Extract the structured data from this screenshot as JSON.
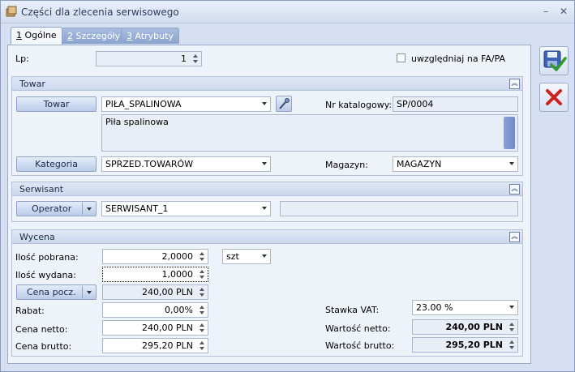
{
  "window": {
    "title": "Części dla zlecenia serwisowego",
    "minimize": "–",
    "close": "✕"
  },
  "tabs": [
    {
      "num": "1",
      "label": "Ogólne"
    },
    {
      "num": "2",
      "label": "Szczegóły"
    },
    {
      "num": "3",
      "label": "Atrybuty"
    }
  ],
  "top": {
    "lp_label": "Lp:",
    "lp_value": "1",
    "checkbox_label": "uwzględniaj na FA/PA"
  },
  "towar": {
    "title": "Towar",
    "button": "Towar",
    "value": "PIŁA_SPALINOWA",
    "catalog_label": "Nr katalogowy:",
    "catalog_value": "SP/0004",
    "description": "Piła spalinowa",
    "category_button": "Kategoria",
    "category_value": "SPRZED.TOWARÓW",
    "warehouse_label": "Magazyn:",
    "warehouse_value": "MAGAZYN"
  },
  "serwisant": {
    "title": "Serwisant",
    "button": "Operator",
    "value": "SERWISANT_1",
    "extra": ""
  },
  "wycena": {
    "title": "Wycena",
    "qty_taken_label": "Ilość pobrana:",
    "qty_taken": "2,0000",
    "unit": "szt",
    "qty_issued_label": "Ilość wydana:",
    "qty_issued": "1,0000",
    "price_button": "Cena pocz.",
    "price_initial": "240,00 PLN",
    "discount_label": "Rabat:",
    "discount": "0,00%",
    "net_label": "Cena netto:",
    "net": "240,00 PLN",
    "gross_label": "Cena brutto:",
    "gross": "295,20 PLN",
    "vat_label": "Stawka VAT:",
    "vat": "23.00 %",
    "net_value_label": "Wartość netto:",
    "net_value": "240,00 PLN",
    "gross_value_label": "Wartość brutto:",
    "gross_value": "295,20 PLN"
  },
  "icons": [
    "save-icon",
    "cancel-icon",
    "picker-icon",
    "app-icon"
  ],
  "colors": {
    "tab_active": "#f3f6fb",
    "tab_inactive": "#8aa3cf",
    "panel": "#eef2f9",
    "cancel_red": "#d02020"
  }
}
